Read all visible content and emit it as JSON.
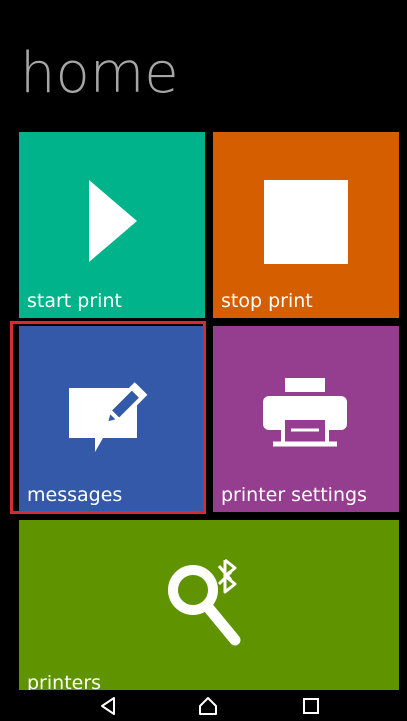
{
  "app": {
    "title": "home"
  },
  "tiles": {
    "start_print": {
      "label": "start print",
      "icon": "play-icon",
      "color": "#00b38a"
    },
    "stop_print": {
      "label": "stop print",
      "icon": "stop-icon",
      "color": "#d55f00"
    },
    "messages": {
      "label": "messages",
      "icon": "message-edit-icon",
      "color": "#3359a8"
    },
    "printer_settings": {
      "label": "printer settings",
      "icon": "printer-icon",
      "color": "#953e8f"
    },
    "printers": {
      "label": "printers",
      "icon": "bluetooth-search-icon",
      "color": "#5f9300"
    }
  },
  "highlight": {
    "target": "messages",
    "color": "#d62b33"
  },
  "navbar": {
    "back": "back-icon",
    "home": "home-icon",
    "recents": "recents-icon"
  }
}
